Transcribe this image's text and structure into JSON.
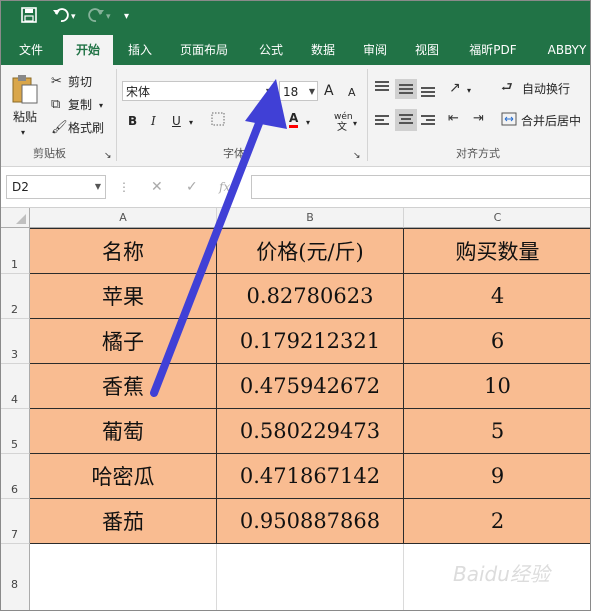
{
  "qat": {
    "save_icon": "save-icon",
    "undo_icon": "undo-icon",
    "redo_icon": "redo-icon",
    "customize_icon": "customize-icon"
  },
  "tabs": [
    "文件",
    "开始",
    "插入",
    "页面布局",
    "公式",
    "数据",
    "审阅",
    "视图",
    "福昕PDF",
    "ABBYY"
  ],
  "active_tab": "开始",
  "ribbon": {
    "clipboard": {
      "paste": "粘贴",
      "cut": "剪切",
      "copy": "复制",
      "format_painter": "格式刷",
      "label": "剪贴板"
    },
    "font": {
      "name": "宋体",
      "size": "18",
      "label": "字体",
      "bold": "B",
      "italic": "I",
      "underline": "U",
      "grow": "A",
      "shrink": "A",
      "phonetic_top": "wén",
      "phonetic_bottom": "文"
    },
    "alignment": {
      "wrap": "自动换行",
      "merge": "合并后居中",
      "label": "对齐方式"
    }
  },
  "formula_bar": {
    "name_box": "D2",
    "cancel": "✕",
    "enter": "✓",
    "fx": "fx",
    "value": ""
  },
  "columns": [
    "A",
    "B",
    "C"
  ],
  "rows": [
    "1",
    "2",
    "3",
    "4",
    "5",
    "6",
    "7",
    "8"
  ],
  "table": {
    "header": [
      "名称",
      "价格(元/斤)",
      "购买数量"
    ],
    "data": [
      [
        "苹果",
        "0.82780623",
        "4"
      ],
      [
        "橘子",
        "0.179212321",
        "6"
      ],
      [
        "香蕉",
        "0.475942672",
        "10"
      ],
      [
        "葡萄",
        "0.580229473",
        "5"
      ],
      [
        "哈密瓜",
        "0.471867142",
        "9"
      ],
      [
        "番茄",
        "0.950887868",
        "2"
      ]
    ]
  },
  "colors": {
    "ribbon_green": "#217346",
    "cell_fill": "#f9bc91",
    "arrow": "#3f3fd0"
  },
  "watermark": "Baidu经验"
}
